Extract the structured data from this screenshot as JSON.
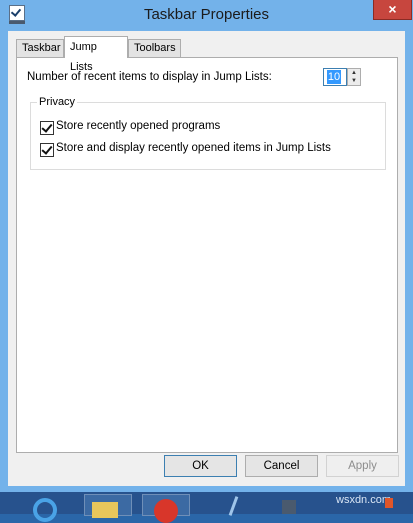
{
  "window": {
    "title": "Taskbar Properties",
    "close_glyph": "×",
    "app_icon": "taskbar-properties-icon"
  },
  "tabs": [
    {
      "label": "Taskbar",
      "active": false
    },
    {
      "label": "Jump Lists",
      "active": true
    },
    {
      "label": "Toolbars",
      "active": false
    }
  ],
  "jump_lists": {
    "recent_items_label": "Number of recent items to display in Jump Lists:",
    "recent_items_value": "10",
    "privacy": {
      "legend": "Privacy",
      "options": [
        {
          "label": "Store recently opened programs",
          "checked": true
        },
        {
          "label": "Store and display recently opened items in Jump Lists",
          "checked": true
        }
      ]
    }
  },
  "buttons": {
    "ok": "OK",
    "cancel": "Cancel",
    "apply": "Apply",
    "apply_enabled": false
  },
  "taskbar": {
    "items": [
      "internet-explorer-icon",
      "file-explorer-icon",
      "opera-icon",
      "pen-icon",
      "windows-icon"
    ],
    "watermark": "wsxdn.com"
  },
  "colors": {
    "window_frame": "#73b2ea",
    "close_button": "#c7463e",
    "spin_selection": "#3399ff",
    "taskbar": "#27528d"
  }
}
